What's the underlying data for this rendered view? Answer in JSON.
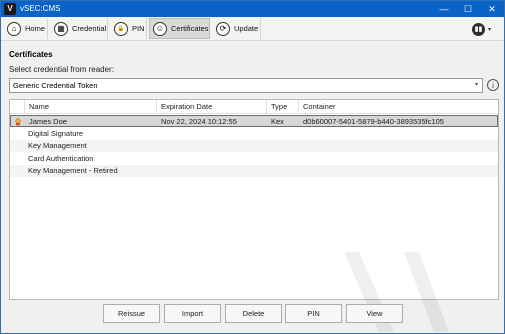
{
  "window": {
    "title": "vSEC:CMS",
    "logo_letter": "V",
    "minimize": "—",
    "maximize": "☐",
    "close": "✕"
  },
  "toolbar": {
    "items": [
      {
        "label": "Home",
        "glyph": "⌂"
      },
      {
        "label": "Credential",
        "glyph": "▦"
      },
      {
        "label": "PIN",
        "glyph": "🔒"
      },
      {
        "label": "Certificates",
        "glyph": "☺"
      },
      {
        "label": "Update",
        "glyph": "⟳"
      }
    ],
    "menu_glyph": "▮▮",
    "menu_caret": "▾"
  },
  "section": {
    "title": "Certificates",
    "select_label": "Select credential from reader:"
  },
  "reader_select": {
    "value": "Generic Credential Token",
    "arrow": "▾"
  },
  "info_glyph": "i",
  "table": {
    "columns": [
      "Name",
      "Expiration Date",
      "Type",
      "Container"
    ],
    "rows": [
      {
        "name": "James Doe",
        "expiration": "Nov 22, 2024 10:12:55",
        "type": "Kex",
        "container": "d0b60007-5401-5879-b440-3893535fc105",
        "selected": true,
        "icon": "certificate-icon"
      },
      {
        "name": "Digital Signature",
        "expiration": "",
        "type": "",
        "container": ""
      },
      {
        "name": "Key Management",
        "expiration": "",
        "type": "",
        "container": ""
      },
      {
        "name": "Card Authentication",
        "expiration": "",
        "type": "",
        "container": ""
      },
      {
        "name": "Key Management - Retired",
        "expiration": "",
        "type": "",
        "container": ""
      }
    ]
  },
  "buttons": {
    "reissue": "Reissue",
    "import": "Import",
    "delete": "Delete",
    "pin": "PIN",
    "view": "View"
  }
}
